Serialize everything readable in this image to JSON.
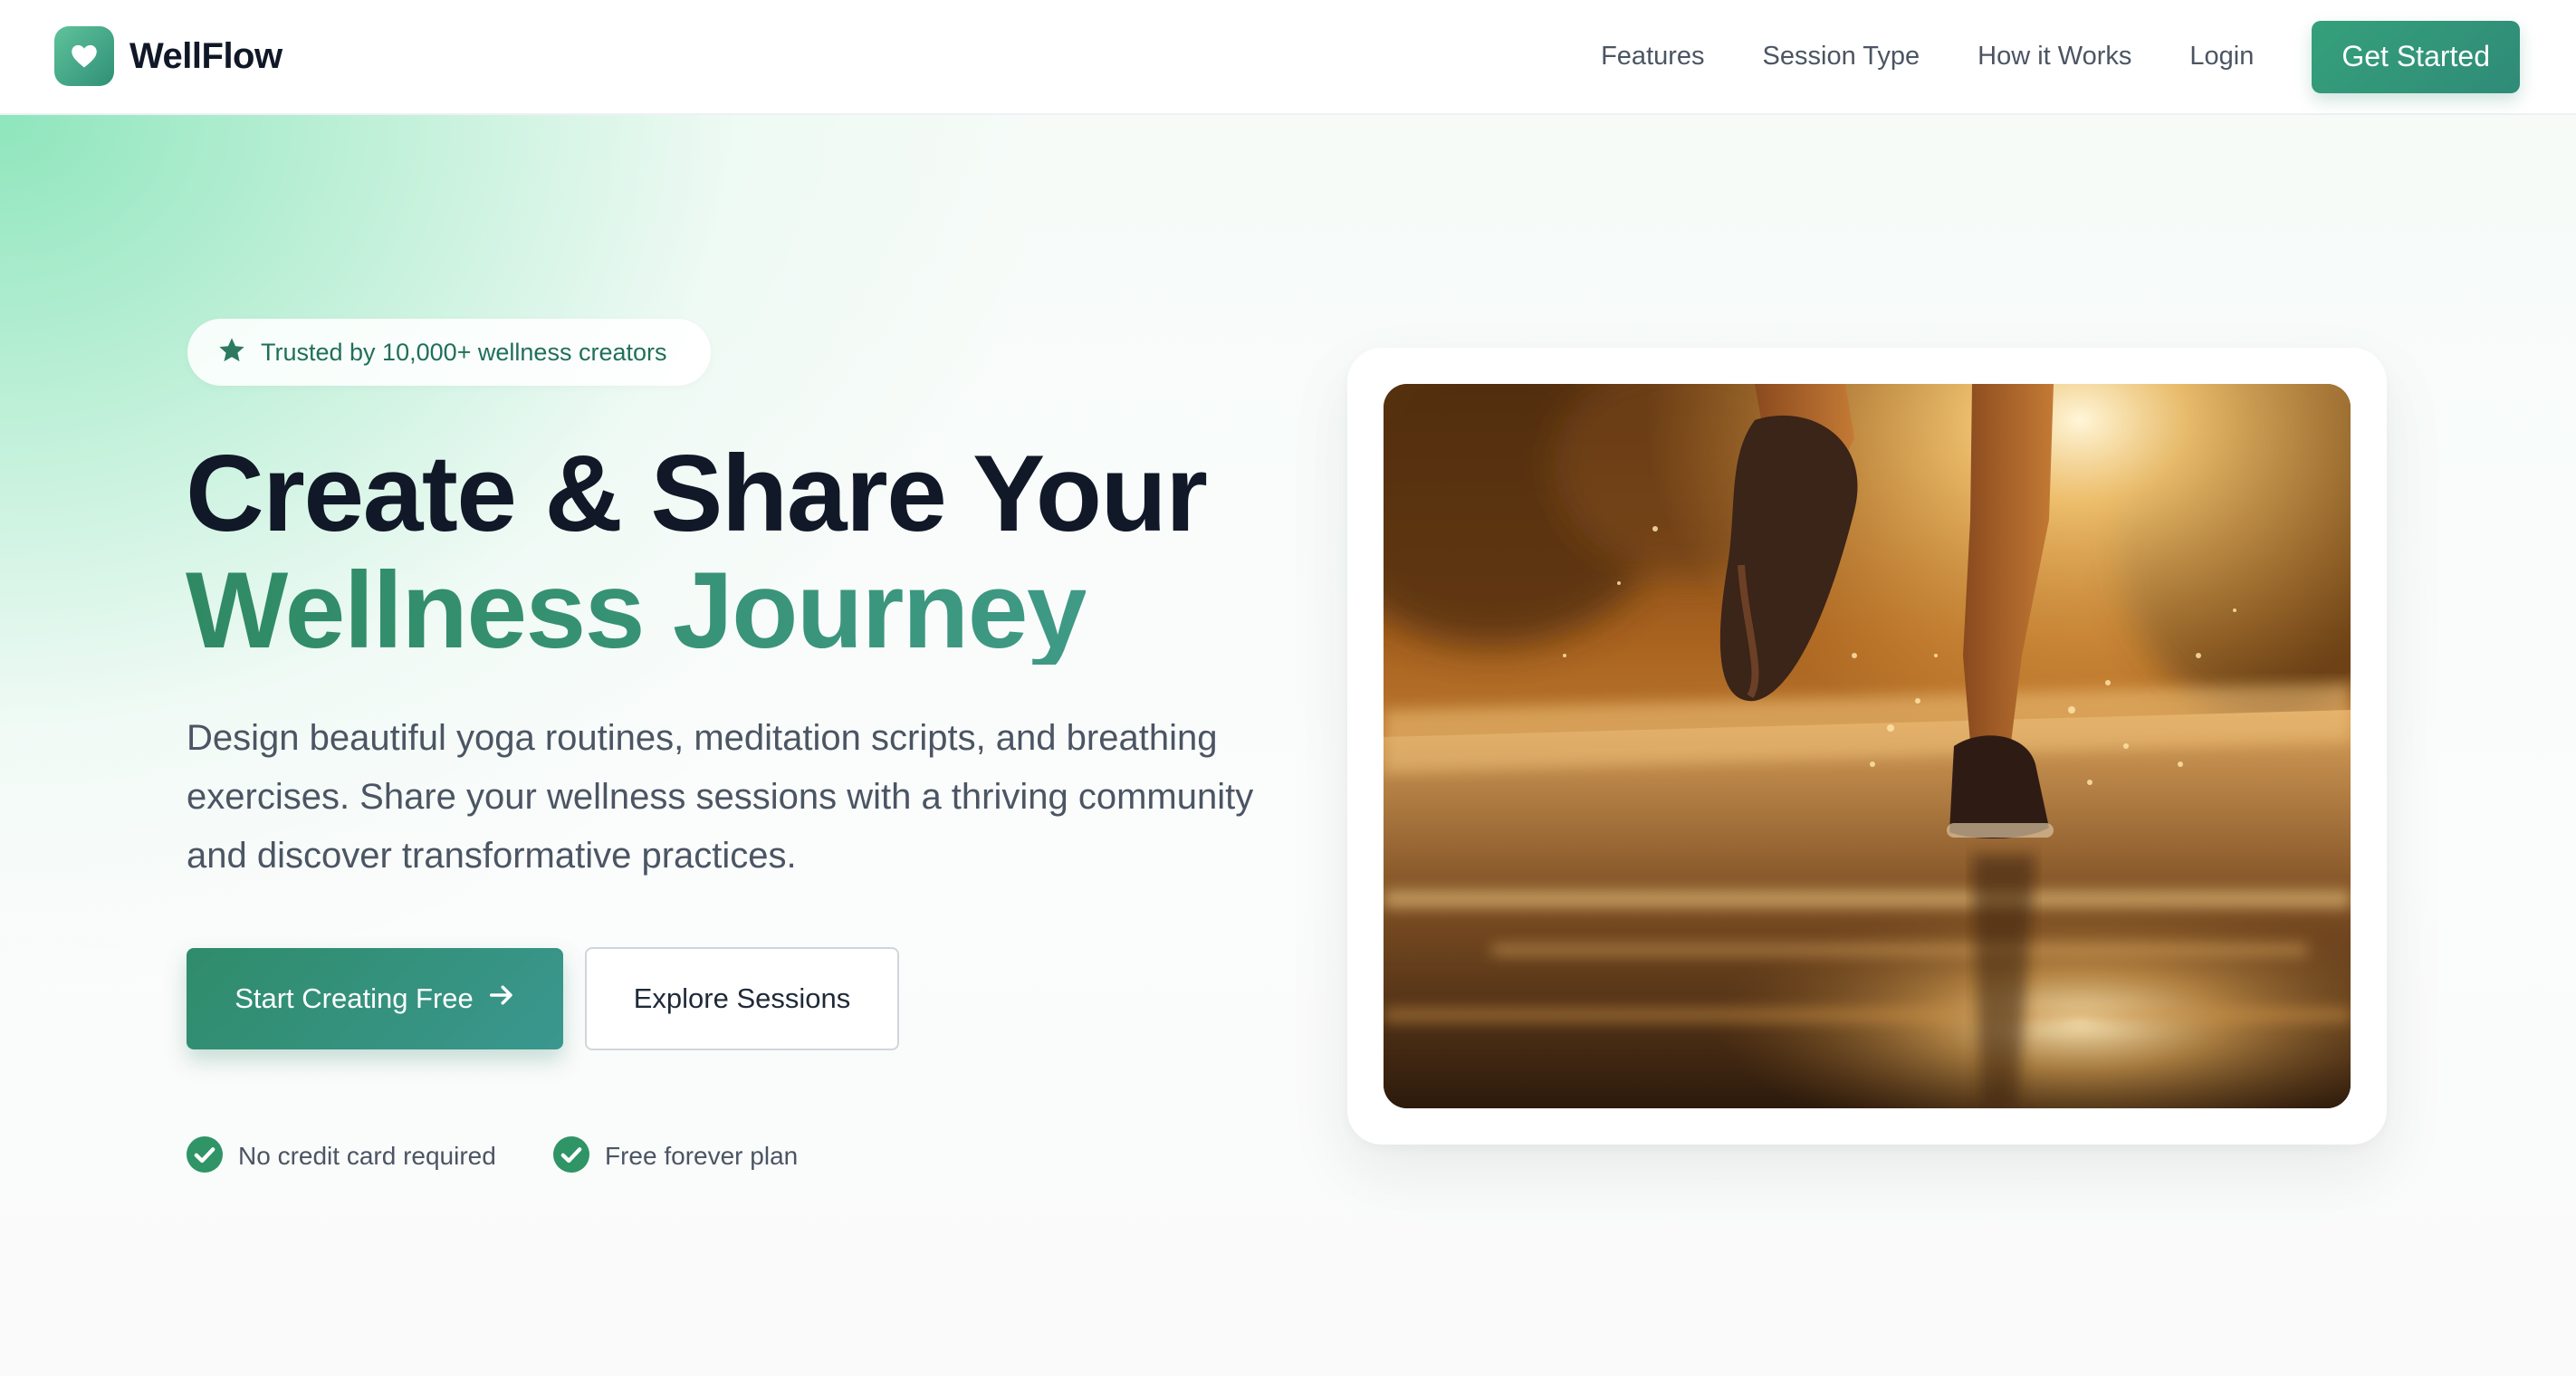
{
  "brand": {
    "name": "WellFlow",
    "icon": "heart-icon"
  },
  "nav": {
    "links": [
      "Features",
      "Session Type",
      "How it Works",
      "Login"
    ],
    "cta_label": "Get Started"
  },
  "hero": {
    "badge": {
      "icon": "star-icon",
      "text": "Trusted by 10,000+ wellness creators"
    },
    "headline_line1": "Create & Share Your",
    "headline_line2": "Wellness Journey",
    "description": "Design beautiful yoga routines, meditation scripts, and breathing exercises. Share your wellness sessions with a thriving community and discover transformative practices.",
    "primary_button": {
      "label": "Start Creating Free",
      "icon": "arrow-right-icon"
    },
    "secondary_button": {
      "label": "Explore Sessions"
    },
    "perks": [
      {
        "icon": "check-circle-icon",
        "text": "No credit card required"
      },
      {
        "icon": "check-circle-icon",
        "text": "Free forever plan"
      }
    ],
    "image": {
      "subject": "runner splashing through a puddle at sunset"
    }
  },
  "colors": {
    "brand_green": "#2f8f76",
    "accent_green": "#35a07a",
    "headline_dark": "#111827",
    "body_gray": "#4b5563"
  }
}
